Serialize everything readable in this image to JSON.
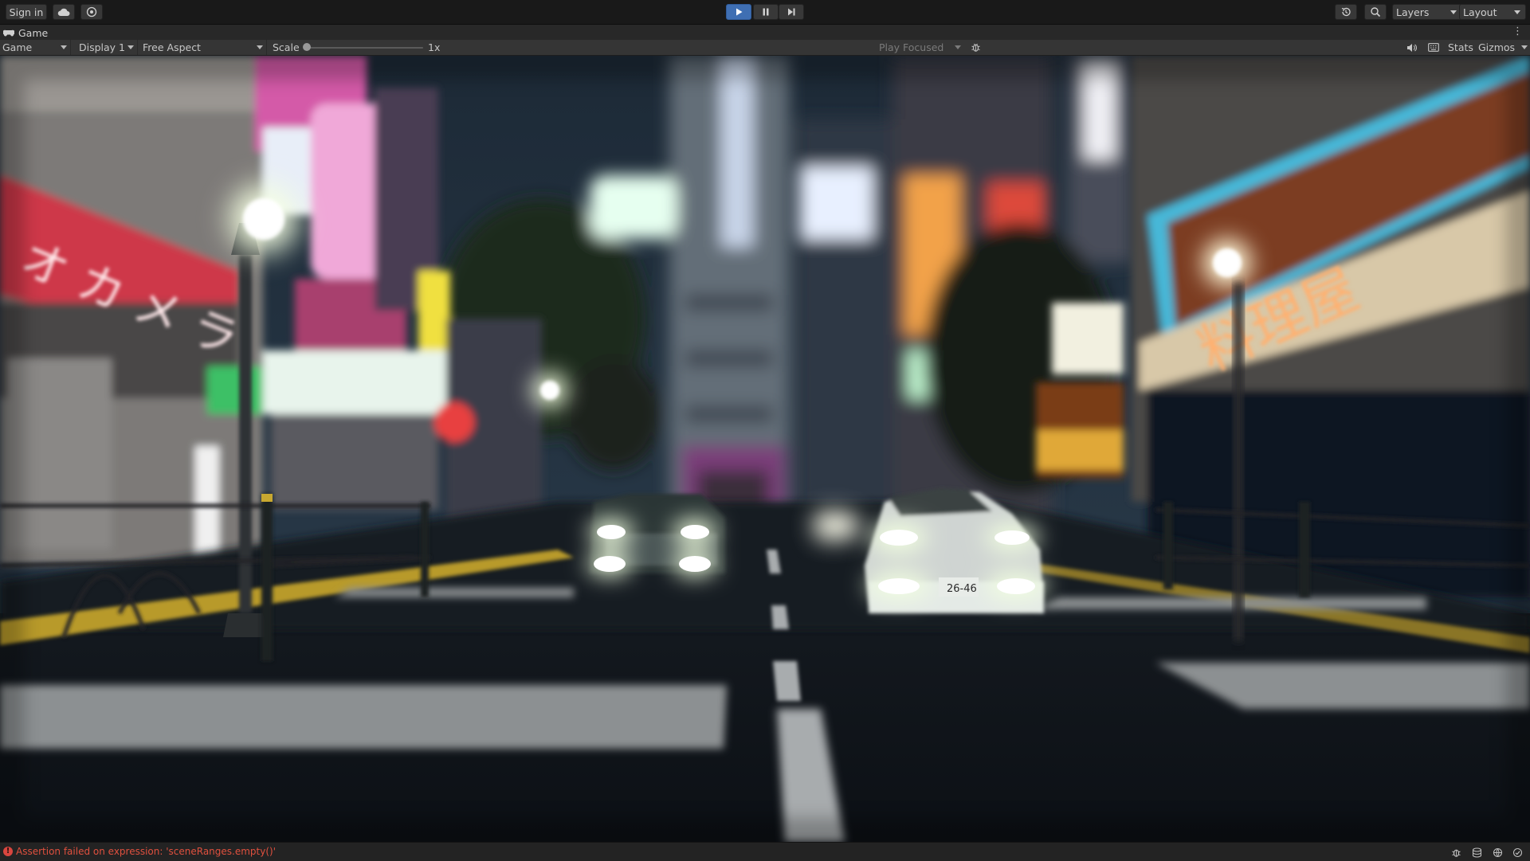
{
  "toolbar": {
    "sign_in": "Sign in",
    "layers": "Layers",
    "layout": "Layout",
    "icons": {
      "cloud": "cloud-icon",
      "collab": "collab-icon",
      "play": "play-icon",
      "pause": "pause-icon",
      "step": "step-icon",
      "history": "history-icon",
      "search": "search-icon"
    },
    "play_active_color": "#3f6fb3"
  },
  "tab": {
    "title": "Game",
    "icon": "gamepad-icon"
  },
  "game_view": {
    "view_mode": "Game",
    "display": "Display 1",
    "aspect": "Free Aspect",
    "scale_label": "Scale",
    "scale_value": "1x",
    "scale_fraction": 0.0,
    "play_focused": "Play Focused",
    "stats": "Stats",
    "gizmos": "Gizmos"
  },
  "scene": {
    "description_icon": "game-render",
    "sign_text_left": "オカメラ CAMERA",
    "license_plate": "26-46"
  },
  "status": {
    "error_message": "Assertion failed on expression: 'sceneRanges.empty()'",
    "error_color": "#e0503e"
  }
}
